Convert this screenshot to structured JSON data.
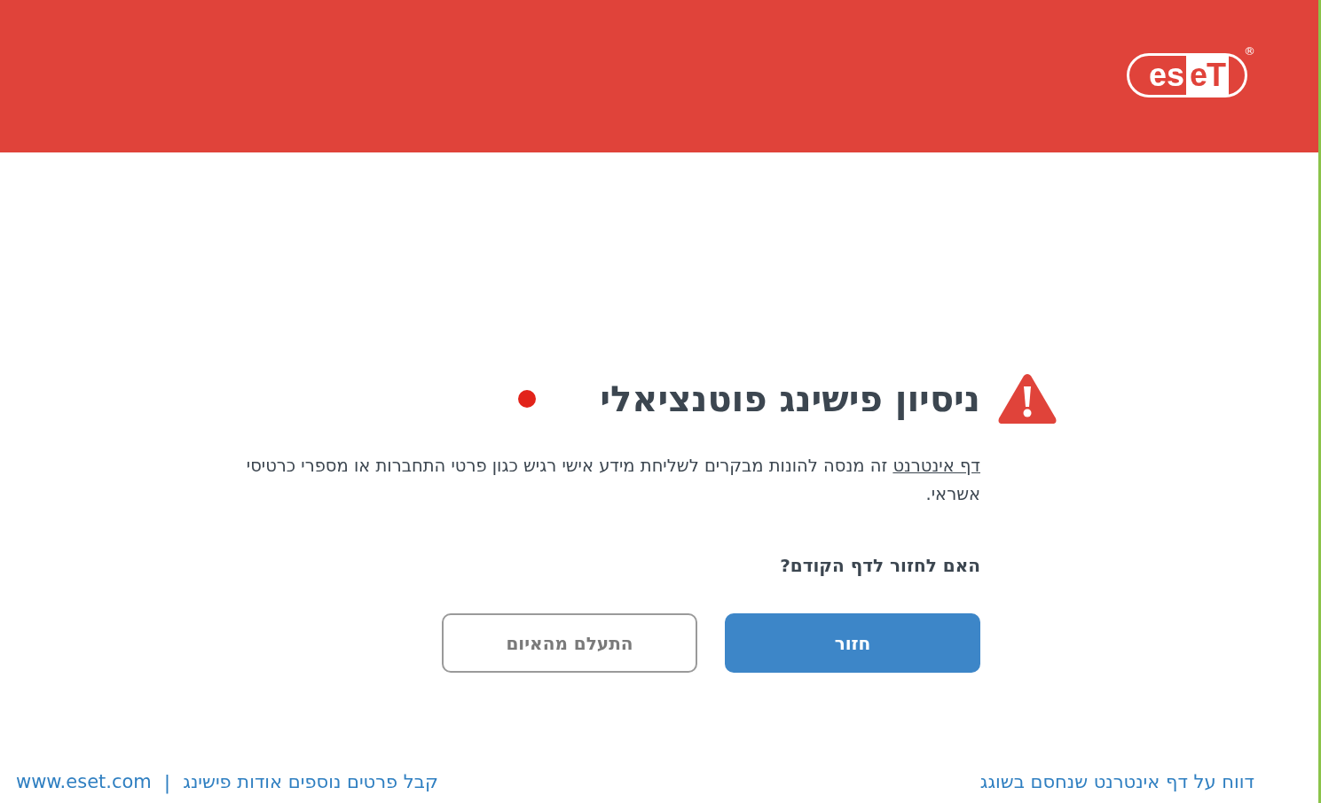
{
  "header": {
    "logo": {
      "part_1": "es",
      "part_2": "eT",
      "registered": "®"
    }
  },
  "alert": {
    "title": "ניסיון פישינג פוטנציאלי",
    "link_text": "דף אינטרנט",
    "description": " זה מנסה להונות מבקרים לשליחת מידע אישי רגיש כגון פרטי התחברות או מספרי כרטיסי אשראי.",
    "question": "האם לחזור לדף הקודם?"
  },
  "buttons": [
    {
      "kind": "primary",
      "label": "חזור"
    },
    {
      "kind": "secondary",
      "label": "התעלם מהאיום"
    }
  ],
  "footer": {
    "report_link": "דווח על דף אינטרנט שנחסם בשוגג",
    "learn_link": "קבל פרטים נוספים אודות פישינג",
    "separator": "|",
    "site_link": "www.eset.com"
  }
}
